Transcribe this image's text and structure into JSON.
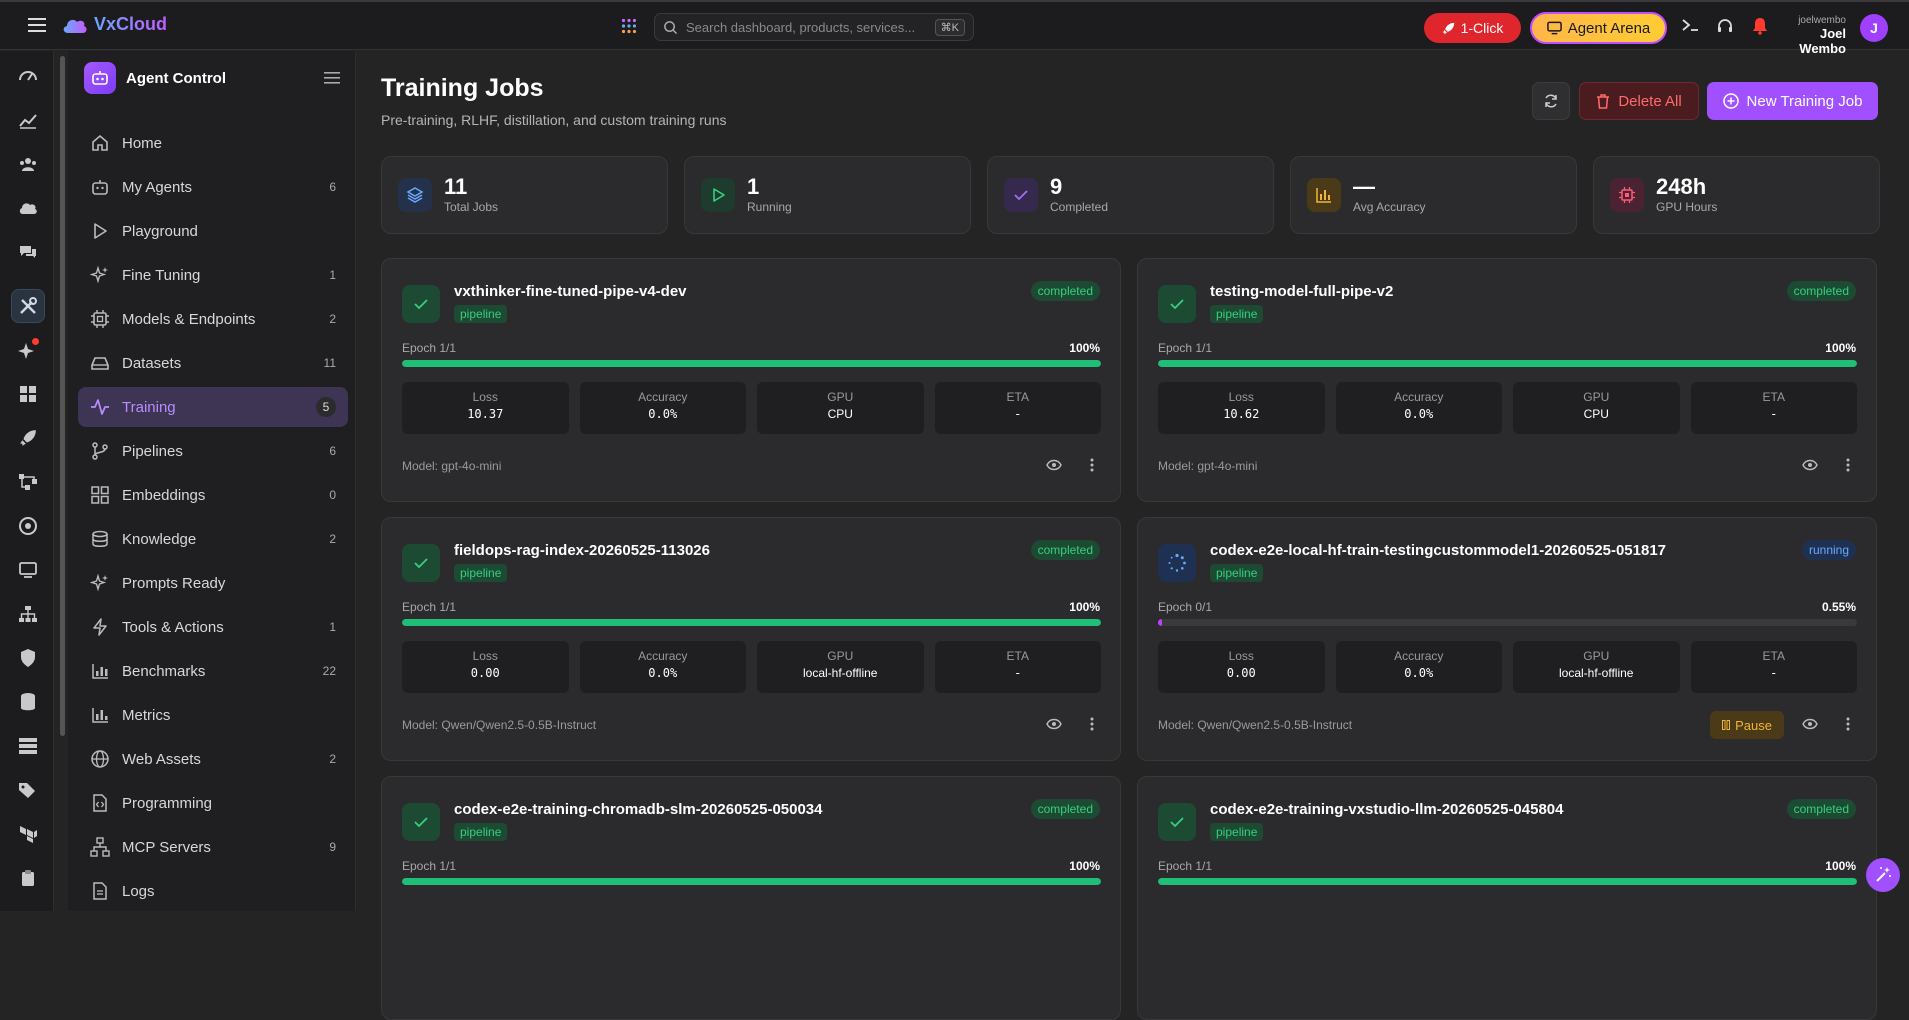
{
  "app": {
    "name": "VxCloud"
  },
  "topbar": {
    "search_placeholder": "Search dashboard, products, services...",
    "search_shortcut": "⌘K",
    "oneclick_label": "1-Click",
    "arena_label": "Agent Arena",
    "user_handle": "joelwembo",
    "user_name": "Joel Wembo",
    "avatar_initial": "J"
  },
  "sidebar": {
    "title": "Agent Control",
    "items": [
      {
        "label": "Home",
        "count": "",
        "icon": "home-icon"
      },
      {
        "label": "My Agents",
        "count": "6",
        "icon": "robot-icon"
      },
      {
        "label": "Playground",
        "count": "",
        "icon": "play-icon"
      },
      {
        "label": "Fine Tuning",
        "count": "1",
        "icon": "sparkles-icon"
      },
      {
        "label": "Models & Endpoints",
        "count": "2",
        "icon": "chip-icon"
      },
      {
        "label": "Datasets",
        "count": "11",
        "icon": "drive-icon"
      },
      {
        "label": "Training",
        "count": "5",
        "icon": "activity-icon"
      },
      {
        "label": "Pipelines",
        "count": "6",
        "icon": "git-branch-icon"
      },
      {
        "label": "Embeddings",
        "count": "0",
        "icon": "grid-icon"
      },
      {
        "label": "Knowledge",
        "count": "2",
        "icon": "database-icon"
      },
      {
        "label": "Prompts Ready",
        "count": "",
        "icon": "sparkles-icon"
      },
      {
        "label": "Tools & Actions",
        "count": "1",
        "icon": "bolt-icon"
      },
      {
        "label": "Benchmarks",
        "count": "22",
        "icon": "bar-chart-icon"
      },
      {
        "label": "Metrics",
        "count": "",
        "icon": "chart-icon"
      },
      {
        "label": "Web Assets",
        "count": "2",
        "icon": "globe-icon"
      },
      {
        "label": "Programming",
        "count": "",
        "icon": "code-file-icon"
      },
      {
        "label": "MCP Servers",
        "count": "9",
        "icon": "network-icon"
      },
      {
        "label": "Logs",
        "count": "",
        "icon": "file-icon"
      }
    ]
  },
  "page": {
    "title": "Training Jobs",
    "subtitle": "Pre-training, RLHF, distillation, and custom training runs",
    "delete_label": "Delete All",
    "new_label": "New Training Job"
  },
  "stats": [
    {
      "value": "11",
      "label": "Total Jobs",
      "color": "#6aa8ff"
    },
    {
      "value": "1",
      "label": "Running",
      "color": "#35d07f"
    },
    {
      "value": "9",
      "label": "Completed",
      "color": "#a56bff"
    },
    {
      "value": "—",
      "label": "Avg Accuracy",
      "color": "#f3b33a"
    },
    {
      "value": "248h",
      "label": "GPU Hours",
      "color": "#ff5a7a"
    }
  ],
  "metric_labels": {
    "loss": "Loss",
    "accuracy": "Accuracy",
    "gpu": "GPU",
    "eta": "ETA"
  },
  "jobs": [
    {
      "name": "vxthinker-fine-tuned-pipe-v4-dev",
      "tag": "pipeline",
      "status": "completed",
      "epoch": "Epoch 1/1",
      "pct": "100%",
      "progress": 1.0,
      "loss": "10.37",
      "accuracy": "0.0%",
      "gpu": "CPU",
      "eta": "-",
      "model": "Model: gpt-4o-mini"
    },
    {
      "name": "testing-model-full-pipe-v2",
      "tag": "pipeline",
      "status": "completed",
      "epoch": "Epoch 1/1",
      "pct": "100%",
      "progress": 1.0,
      "loss": "10.62",
      "accuracy": "0.0%",
      "gpu": "CPU",
      "eta": "-",
      "model": "Model: gpt-4o-mini"
    },
    {
      "name": "fieldops-rag-index-20260525-113026",
      "tag": "pipeline",
      "status": "completed",
      "epoch": "Epoch 1/1",
      "pct": "100%",
      "progress": 1.0,
      "loss": "0.00",
      "accuracy": "0.0%",
      "gpu": "local-hf-offline",
      "eta": "-",
      "model": "Model: Qwen/Qwen2.5-0.5B-Instruct"
    },
    {
      "name": "codex-e2e-local-hf-train-testingcustommodel1-20260525-051817",
      "tag": "pipeline",
      "status": "running",
      "epoch": "Epoch 0/1",
      "pct": "0.55%",
      "progress": 0.0055,
      "loss": "0.00",
      "accuracy": "0.0%",
      "gpu": "local-hf-offline",
      "eta": "-",
      "model": "Model: Qwen/Qwen2.5-0.5B-Instruct",
      "pause_label": "Pause"
    },
    {
      "name": "codex-e2e-training-chromadb-slm-20260525-050034",
      "tag": "pipeline",
      "status": "completed",
      "epoch": "Epoch 1/1",
      "pct": "100%",
      "progress": 1.0,
      "loss": "",
      "accuracy": "",
      "gpu": "",
      "eta": "",
      "model": ""
    },
    {
      "name": "codex-e2e-training-vxstudio-llm-20260525-045804",
      "tag": "pipeline",
      "status": "completed",
      "epoch": "Epoch 1/1",
      "pct": "100%",
      "progress": 1.0,
      "loss": "",
      "accuracy": "",
      "gpu": "",
      "eta": "",
      "model": ""
    }
  ]
}
